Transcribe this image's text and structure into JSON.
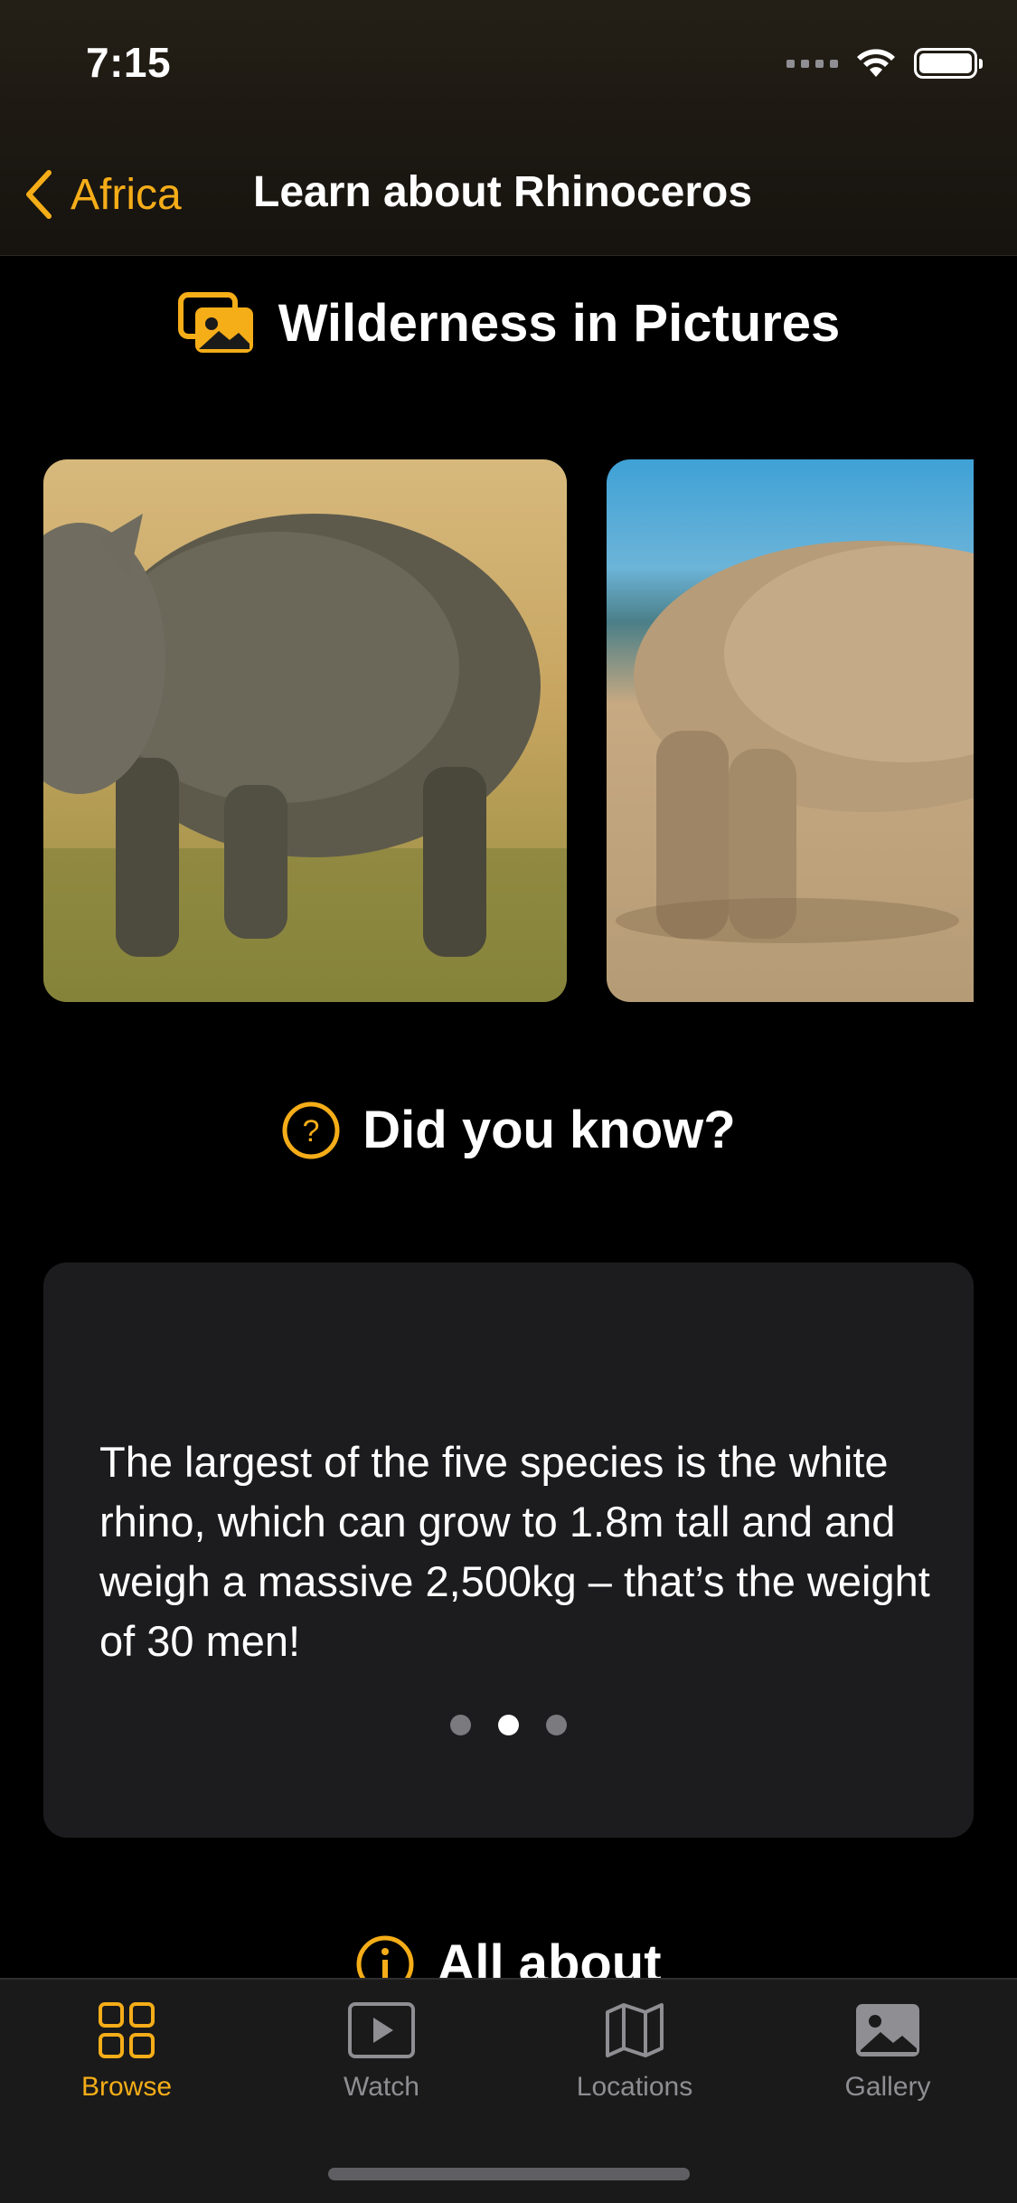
{
  "status": {
    "time": "7:15"
  },
  "nav": {
    "back_label": "Africa",
    "title": "Learn about Rhinoceros"
  },
  "gallery": {
    "heading": "Wilderness in Pictures",
    "images": [
      "rhino-photo-grassland",
      "rhino-photo-blue-sky"
    ]
  },
  "fact": {
    "heading": "Did you know?",
    "text": "The largest of the five species is the white rhino, which can grow to 1.8m tall and and weigh a massive 2,500kg – that’s the weight of 30 men!",
    "page_count": 3,
    "current_page": 2
  },
  "about": {
    "heading": "All about"
  },
  "tabs": [
    {
      "label": "Browse",
      "icon": "grid-icon",
      "active": true
    },
    {
      "label": "Watch",
      "icon": "play-icon",
      "active": false
    },
    {
      "label": "Locations",
      "icon": "map-icon",
      "active": false
    },
    {
      "label": "Gallery",
      "icon": "photo-icon",
      "active": false
    }
  ],
  "colors": {
    "accent": "#f5ad18",
    "card": "#1c1c1e",
    "background": "#000000"
  }
}
